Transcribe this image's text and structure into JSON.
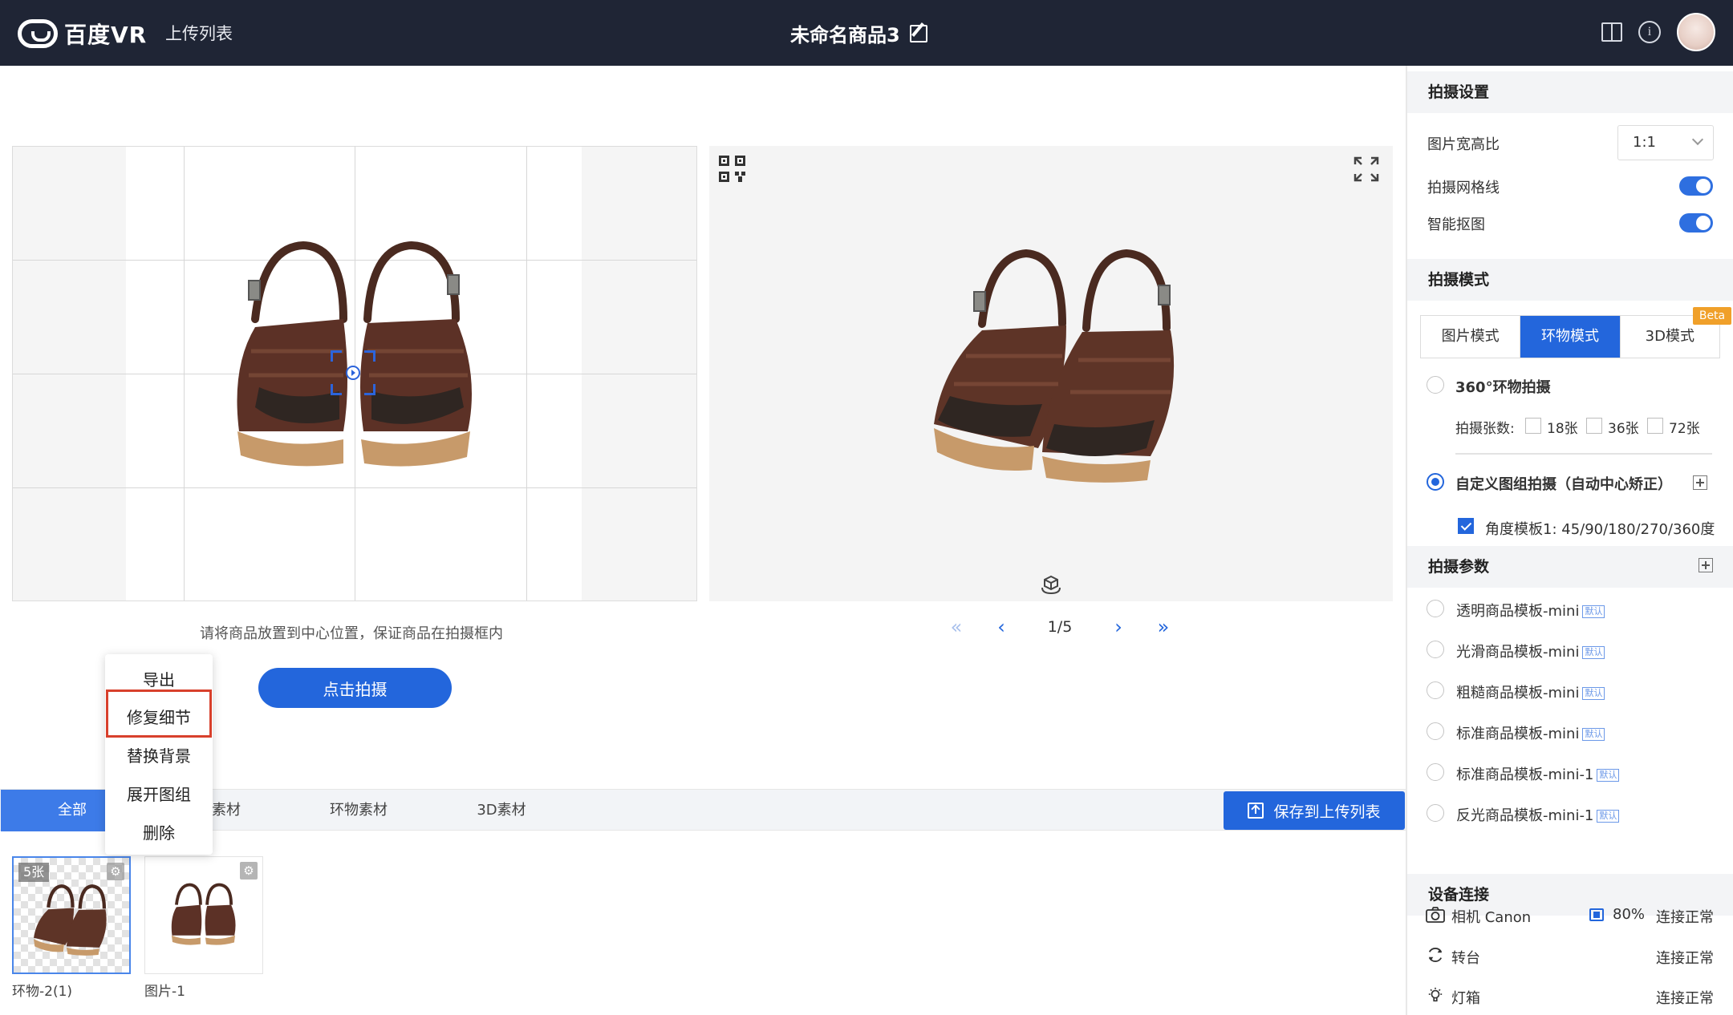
{
  "header": {
    "logo_text": "百度VR",
    "upload_list_label": "上传列表",
    "title": "未命名商品3"
  },
  "capture": {
    "hint": "请将商品放置到中心位置，保证商品在拍摄框内",
    "shoot_button": "点击拍摄"
  },
  "preview": {
    "page_indicator": "1/5"
  },
  "context_menu": {
    "items": [
      "导出",
      "修复细节",
      "替换背景",
      "展开图组",
      "删除"
    ],
    "highlighted": "修复细节"
  },
  "tabs": {
    "all": "全部",
    "image_material": "素材",
    "orbit_material": "环物素材",
    "material_3d": "3D素材",
    "save_button": "保存到上传列表"
  },
  "thumbnails": [
    {
      "label": "环物-2(1)",
      "badge": "5张",
      "selected": true
    },
    {
      "label": "图片-1",
      "badge": "",
      "selected": false
    }
  ],
  "panel": {
    "shoot_settings": {
      "title": "拍摄设置",
      "aspect_label": "图片宽高比",
      "aspect_value": "1:1",
      "grid_label": "拍摄网格线",
      "grid_on": true,
      "matting_label": "智能抠图",
      "matting_on": true
    },
    "shoot_mode": {
      "title": "拍摄模式",
      "modes": [
        "图片模式",
        "环物模式",
        "3D模式"
      ],
      "active": "环物模式",
      "beta": "Beta",
      "orbit_360": "360°环物拍摄",
      "count_label": "拍摄张数:",
      "counts": [
        "18张",
        "36张",
        "72张"
      ],
      "custom_group": "自定义图组拍摄（自动中心矫正）",
      "angle_template": "角度模板1: 45/90/180/270/360度"
    },
    "shoot_params": {
      "title": "拍摄参数",
      "default_tag": "默认",
      "templates": [
        "透明商品模板-mini",
        "光滑商品模板-mini",
        "粗糙商品模板-mini",
        "标准商品模板-mini",
        "标准商品模板-mini-1",
        "反光商品模板-mini-1"
      ]
    },
    "devices": {
      "title": "设备连接",
      "camera_label": "相机 Canon",
      "battery": "80%",
      "camera_status": "连接正常",
      "turntable_label": "转台",
      "turntable_status": "连接正常",
      "lightbox_label": "灯箱",
      "lightbox_status": "连接正常"
    }
  },
  "colors": {
    "accent": "#2366dc",
    "topbar": "#1f2535",
    "highlight_border": "#d8402c",
    "beta": "#f0a02a"
  }
}
